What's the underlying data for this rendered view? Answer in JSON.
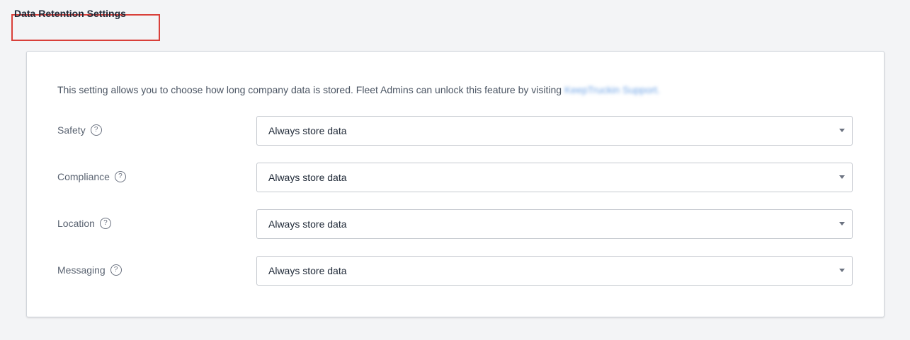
{
  "header": {
    "title": "Data Retention Settings"
  },
  "card": {
    "description": "This setting allows you to choose how long company data is stored. Fleet Admins can unlock this feature by visiting",
    "link_text": "KeepTruckin Support."
  },
  "settings": [
    {
      "label": "Safety",
      "value": "Always store data"
    },
    {
      "label": "Compliance",
      "value": "Always store data"
    },
    {
      "label": "Location",
      "value": "Always store data"
    },
    {
      "label": "Messaging",
      "value": "Always store data"
    }
  ],
  "icons": {
    "help": "question-circle-icon",
    "dropdown": "caret-down-icon"
  },
  "colors": {
    "highlight_border": "#d9403a",
    "link": "#6ea3e6",
    "background": "#f3f4f6"
  }
}
